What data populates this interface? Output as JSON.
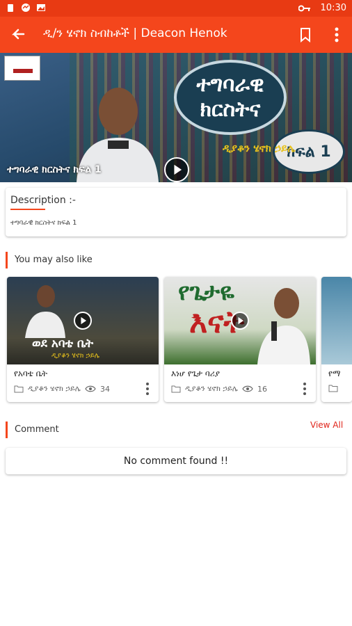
{
  "status_bar": {
    "time": "10:30"
  },
  "app_bar": {
    "title": "ዲ/ን ሄኖክ ስብከቶች | Deacon Henok"
  },
  "hero": {
    "caption": "ተግባራዊ ክርስትና ክፍል 1",
    "oval_line1": "ተግባራዊ",
    "oval_line2": "ክርስትና",
    "part_label": "ክፍል 1",
    "speaker": "ዲያቆን ሄኖክ ኃይሌ"
  },
  "description": {
    "heading": "Description :-",
    "text": "ተግባራዊ ክርስትና ክፍል 1"
  },
  "related": {
    "heading": "You may also like",
    "items": [
      {
        "title": "የአባቴ ቤት",
        "channel": "ዲያቆን ሄኖክ ኃይሌ",
        "views": "34",
        "thumb_text": "ወደ አባቴ ቤት",
        "thumb_sub": "ዲያቆን ሄኖክ ኃይሌ"
      },
      {
        "title": "እነሆ የጌታ ባሪያ",
        "channel": "ዲያቆን ሄኖክ ኃይሌ",
        "views": "16",
        "thumb_text": "የጌታዬ",
        "thumb_text2": "እናት"
      },
      {
        "title": "የማ",
        "channel": "",
        "views": ""
      }
    ]
  },
  "comments": {
    "heading": "Comment",
    "view_all": "View All",
    "empty": "No comment found !!"
  },
  "colors": {
    "primary": "#f4461c",
    "status_bar": "#e83a13",
    "accent_text": "#e0241a"
  }
}
